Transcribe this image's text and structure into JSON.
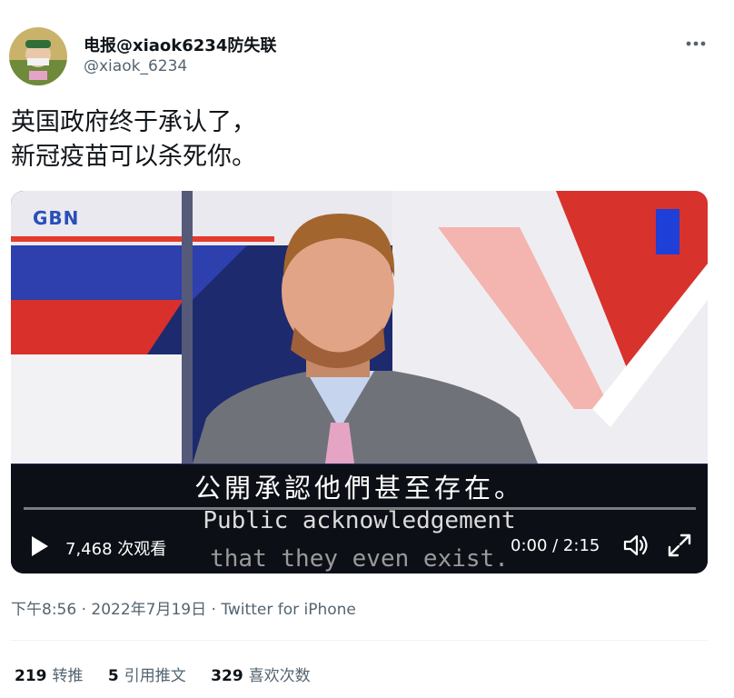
{
  "tweet": {
    "author_name": "电报@xiaok6234防失联",
    "author_handle": "@xiaok_6234",
    "text_line1": "英国政府终于承认了，",
    "text_line2": "新冠疫苗可以杀死你。",
    "timestamp": "下午8:56 · 2022年7月19日",
    "source": "Twitter for iPhone"
  },
  "video": {
    "channel_logo": "GBN",
    "subtitle_cn": "公開承認他們甚至存在。",
    "subtitle_en_line1": "Public acknowledgement",
    "subtitle_en_line2": "that they even exist.",
    "views": "7,468 次观看",
    "time": "0:00 / 2:15",
    "progress": 0.0
  },
  "stats": {
    "retweets_count": "219",
    "retweets_label": "转推",
    "quotes_count": "5",
    "quotes_label": "引用推文",
    "likes_count": "329",
    "likes_label": "喜欢次数"
  },
  "icons": {
    "more": "more-horizontal-icon",
    "play": "play-icon",
    "volume": "volume-icon",
    "fullscreen": "fullscreen-icon"
  },
  "colors": {
    "secondary_text": "#536471",
    "primary_text": "#0f1419",
    "divider": "#eff3f4"
  }
}
